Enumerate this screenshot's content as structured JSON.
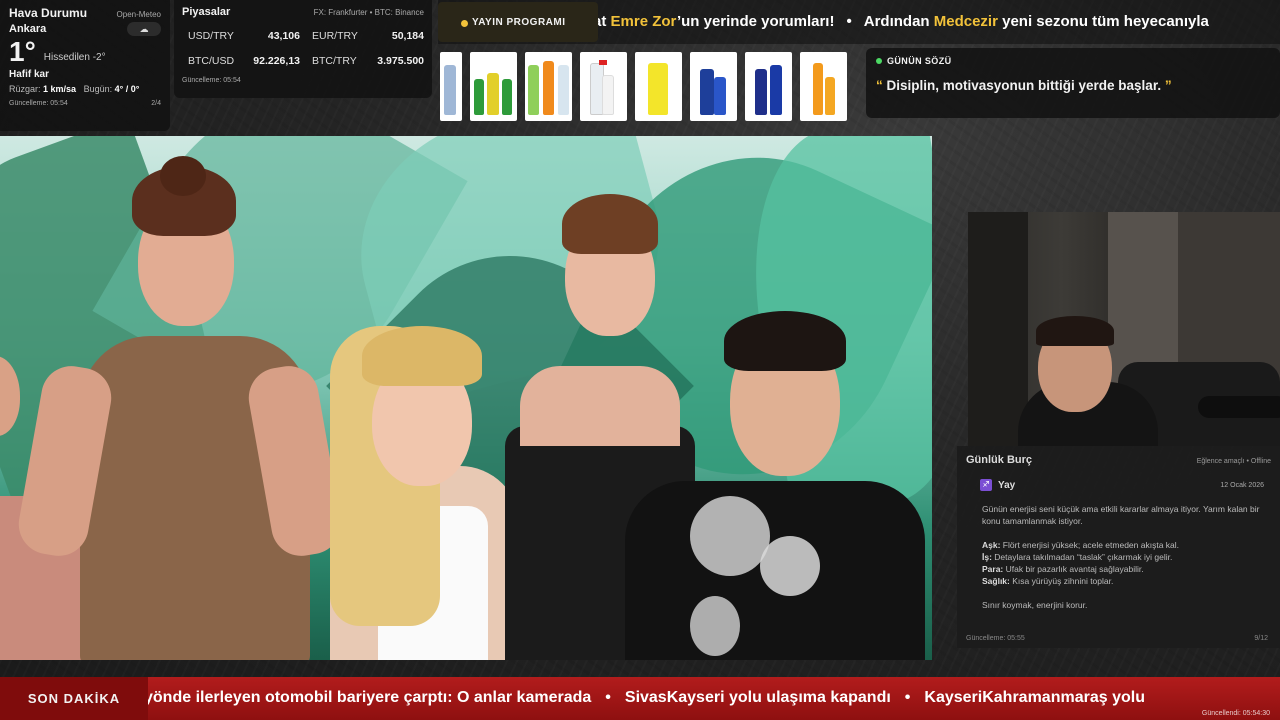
{
  "weather": {
    "title": "Hava Durumu",
    "source": "Open-Meteo",
    "city": "Ankara",
    "icon": "snow-cloud-icon",
    "icon_glyph": "☁",
    "temperature": "1°",
    "feels_like": "Hissedilen -2°",
    "condition": "Hafif kar",
    "wind_label": "Rüzgar:",
    "wind_value": "1 km/sa",
    "today_label": "Bugün:",
    "today_value": "4° / 0°",
    "updated": "Güncelleme: 05:54",
    "page": "2/4"
  },
  "markets": {
    "title": "Piyasalar",
    "source": "FX: Frankfurter • BTC: Binance",
    "rates": [
      {
        "symbol": "USD/TRY",
        "value": "43,106"
      },
      {
        "symbol": "EUR/TRY",
        "value": "50,184"
      },
      {
        "symbol": "BTC/USD",
        "value": "92.226,13"
      },
      {
        "symbol": "BTC/TRY",
        "value": "3.975.500"
      }
    ],
    "updated": "Güncelleme: 05:54"
  },
  "top_ticker": {
    "badge": "YAYIN PROGRAMI",
    "text_a": "at ",
    "highlight_a": "Emre Zor",
    "text_b": "’un yerinde yorumları!",
    "separator": "•",
    "text_c": "Ardından ",
    "highlight_b": "Medcezir",
    "text_d": " yeni sezonu tüm heyecanıyla"
  },
  "quote": {
    "label": "GÜNÜN SÖZÜ",
    "open_mark": "“",
    "text": "Disiplin, motivasyonun bittiği yerde başlar.",
    "close_mark": "”"
  },
  "horoscope": {
    "title": "Günlük Burç",
    "source": "Eğlence amaçlı • Offline",
    "sign": "Yay",
    "sign_icon": "sagittarius-icon",
    "sign_glyph": "♐",
    "date": "12 Ocak 2026",
    "summary": "Günün enerjisi seni küçük ama etkili kararlar almaya itiyor. Yarım kalan bir konu tamamlanmak istiyor.",
    "ask_label": "Aşk:",
    "ask": " Flört enerjisi yüksek; acele etmeden akışta kal.",
    "is_label": "İş:",
    "is": " Detaylara takılmadan “taslak” çıkarmak iyi gelir.",
    "para_label": "Para:",
    "para": " Ufak bir pazarlık avantaj sağlayabilir.",
    "saglik_label": "Sağlık:",
    "saglik": " Kısa yürüyüş zihnini toplar.",
    "advice": "Sınır koymak, enerjini korur.",
    "updated": "Güncelleme: 05:55",
    "page": "9/12"
  },
  "breaking": {
    "badge": "SON DAKİKA",
    "items": [
      "yönde ilerleyen otomobil bariyere çarptı: O anlar kamerada",
      "SivasKayseri yolu ulaşıma kapandı",
      "KayseriKahramanmaraş yolu"
    ],
    "separator": "•",
    "updated": "Güncellendi: 05:54:30"
  }
}
